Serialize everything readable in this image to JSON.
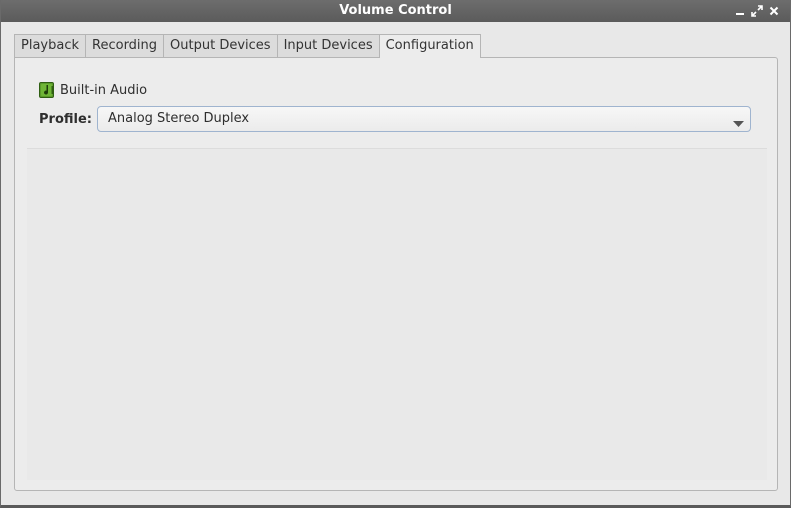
{
  "window": {
    "title": "Volume Control"
  },
  "tabs": [
    {
      "label": "Playback",
      "active": false
    },
    {
      "label": "Recording",
      "active": false
    },
    {
      "label": "Output Devices",
      "active": false
    },
    {
      "label": "Input Devices",
      "active": false
    },
    {
      "label": "Configuration",
      "active": true
    }
  ],
  "card": {
    "device_name": "Built-in Audio",
    "device_icon": "audio-card-icon",
    "profile_label": "Profile:",
    "profile_value": "Analog Stereo Duplex"
  },
  "colors": {
    "titlebar": "#5f5f5f",
    "accent_border": "#9fb4cf",
    "icon_green": "#5a9a2a"
  }
}
